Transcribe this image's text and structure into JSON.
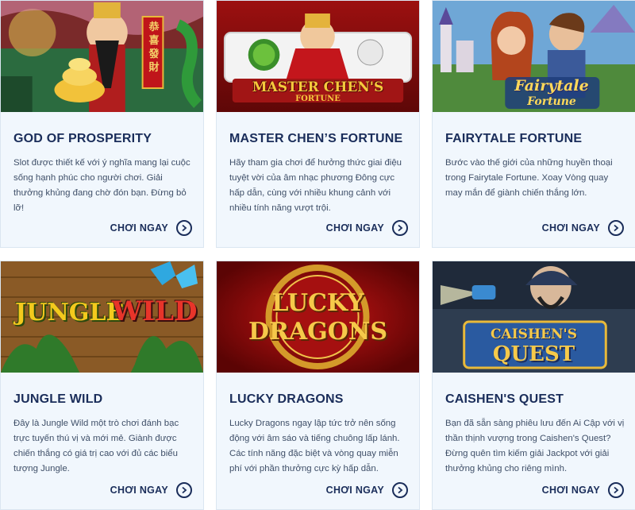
{
  "cards": [
    {
      "title": "GOD OF PROSPERITY",
      "description": "Slot được thiết kế với ý nghĩa mang lại cuộc sống hạnh phúc cho người chơi. Giải thưởng khủng đang chờ đón bạn. Đừng bỏ lỡ!",
      "cta": "CHƠI NGAY",
      "thumb_text": "恭喜發財"
    },
    {
      "title": "MASTER CHEN’S FORTUNE",
      "description": "Hãy tham gia chơi để hưởng thức giai điệu tuyệt vời của âm nhạc phương Đông cực hấp dẫn, cùng với nhiều khung cảnh với nhiều tính năng vượt trội.",
      "cta": "CHƠI NGAY",
      "thumb_text": "MASTER CHEN'S",
      "thumb_subtext": "FORTUNE"
    },
    {
      "title": "FAIRYTALE FORTUNE",
      "description": "Bước vào thế giới của những huyền thoại trong Fairytale Fortune. Xoay Vòng quay may mắn để giành chiến thắng lớn.",
      "cta": "CHƠI NGAY",
      "thumb_text": "Fairytale",
      "thumb_subtext": "Fortune"
    },
    {
      "title": "JUNGLE WILD",
      "description": "Đây là Jungle Wild một trò chơi đánh bạc trực tuyến thú vị và mới mẻ. Giành được chiến thắng có giá trị cao với đủ các biểu tượng Jungle.",
      "cta": "CHƠI NGAY",
      "thumb_text": "JUNGLE",
      "thumb_subtext": "WILD"
    },
    {
      "title": "LUCKY DRAGONS",
      "description": "Lucky Dragons ngay lập tức trở nên sống động với âm sáo và tiếng chuông lấp lánh. Các tính năng đặc biệt và vòng quay miễn phí với phần thưởng cực kỳ hấp dẫn.",
      "cta": "CHƠI NGAY",
      "thumb_text": "LUCKY",
      "thumb_subtext": "DRAGONS"
    },
    {
      "title": "CAISHEN'S QUEST",
      "description": "Bạn đã sẵn sàng phiêu lưu đến Ai Cập với vị thần thịnh vượng trong Caishen's Quest? Đừng quên tìm kiếm giải Jackpot với giải thưởng khủng cho riêng mình.",
      "cta": "CHƠI NGAY",
      "thumb_text": "CAISHEN'S",
      "thumb_subtext": "QUEST"
    }
  ],
  "colors": {
    "title": "#1a2d5a",
    "text": "#3f4f68",
    "card_bg": "#f1f7fd",
    "card_border": "#dbe6f1"
  },
  "icons": {
    "cta": "chevron-right-circle-icon"
  }
}
